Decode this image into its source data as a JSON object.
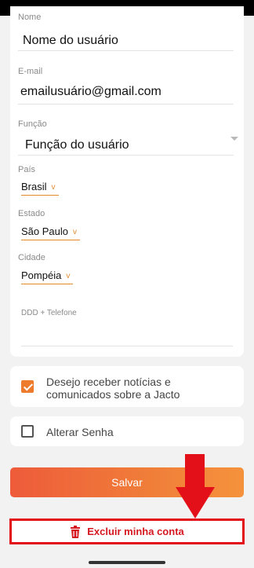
{
  "form": {
    "name_label": "Nome",
    "name_value": "Nome do usuário",
    "email_label": "E-mail",
    "email_value": "emailusuário@gmail.com",
    "role_label": "Função",
    "role_value": "Função do usuário",
    "country_label": "País",
    "country_value": "Brasil",
    "state_label": "Estado",
    "state_value": "São Paulo",
    "city_label": "Cidade",
    "city_value": "Pompéia",
    "phone_label": "DDD + Telefone",
    "phone_value": ""
  },
  "options": {
    "newsletter_text": "Desejo receber notícias e comunicados sobre a Jacto",
    "newsletter_checked": true,
    "change_password_text": "Alterar Senha",
    "change_password_checked": false
  },
  "actions": {
    "save_label": "Salvar",
    "delete_label": "Excluir minha conta"
  },
  "colors": {
    "accent": "#ee7a2b",
    "danger": "#e3101a"
  },
  "icons": {
    "caret": "chevron-down-icon",
    "delete": "trash-icon"
  }
}
